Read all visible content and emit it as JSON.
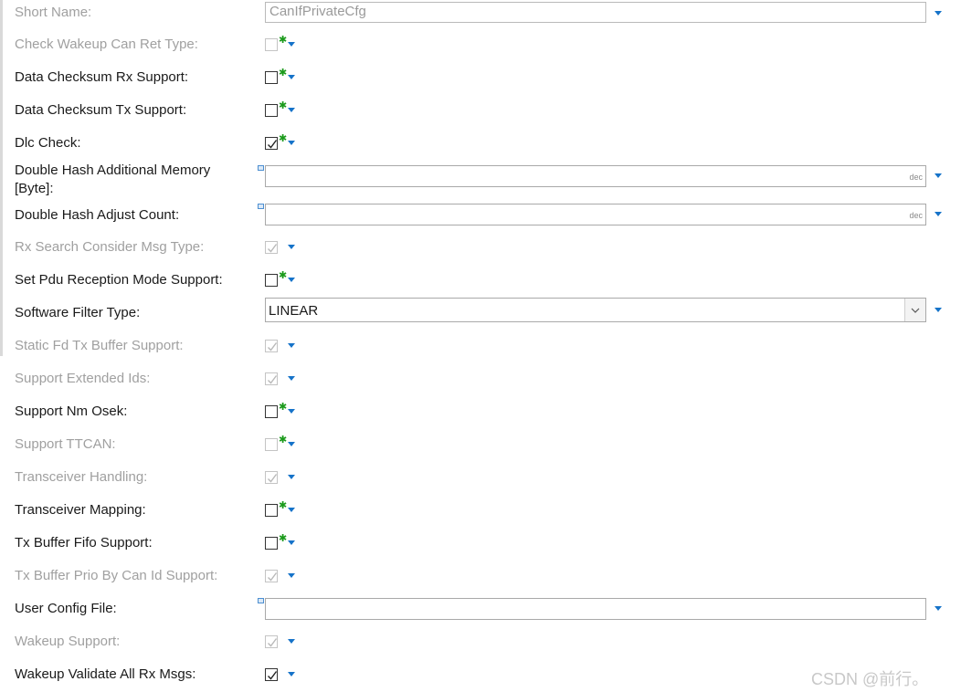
{
  "form": {
    "short_name": {
      "label": "Short Name:",
      "value": "CanIfPrivateCfg"
    },
    "check_wakeup_can_ret_type": {
      "label": "Check Wakeup Can Ret Type:"
    },
    "data_checksum_rx_support": {
      "label": "Data Checksum Rx Support:"
    },
    "data_checksum_tx_support": {
      "label": "Data Checksum Tx Support:"
    },
    "dlc_check": {
      "label": "Dlc Check:"
    },
    "double_hash_additional_memory": {
      "label": "Double Hash Additional Memory [Byte]:",
      "value": "",
      "unit": "dec"
    },
    "double_hash_adjust_count": {
      "label": "Double Hash Adjust Count:",
      "value": "",
      "unit": "dec"
    },
    "rx_search_consider_msg_type": {
      "label": "Rx Search Consider Msg Type:"
    },
    "set_pdu_reception_mode_support": {
      "label": "Set Pdu Reception Mode Support:"
    },
    "software_filter_type": {
      "label": "Software Filter Type:",
      "value": "LINEAR"
    },
    "static_fd_tx_buffer_support": {
      "label": "Static Fd Tx Buffer Support:"
    },
    "support_extended_ids": {
      "label": "Support Extended Ids:"
    },
    "support_nm_osek": {
      "label": "Support Nm Osek:"
    },
    "support_ttcan": {
      "label": "Support TTCAN:"
    },
    "transceiver_handling": {
      "label": "Transceiver Handling:"
    },
    "transceiver_mapping": {
      "label": "Transceiver Mapping:"
    },
    "tx_buffer_fifo_support": {
      "label": "Tx Buffer Fifo Support:"
    },
    "tx_buffer_prio_by_can_id_support": {
      "label": "Tx Buffer Prio By Can Id Support:"
    },
    "user_config_file": {
      "label": "User Config File:",
      "value": ""
    },
    "wakeup_support": {
      "label": "Wakeup Support:"
    },
    "wakeup_validate_all_rx_msgs": {
      "label": "Wakeup Validate All Rx Msgs:"
    }
  },
  "watermark": "CSDN @前行。",
  "colors": {
    "arrow": "#1673c9",
    "star": "#1a9a1a",
    "disabled_text": "#a0a0a0",
    "text": "#1a1a1a"
  }
}
